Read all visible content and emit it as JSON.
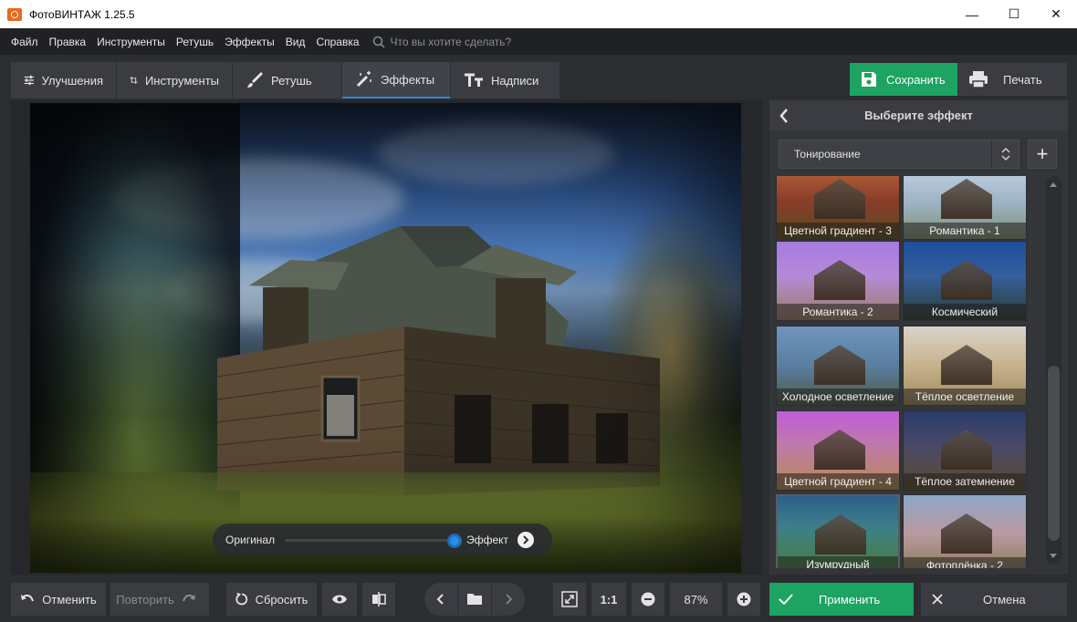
{
  "window": {
    "title": "ФотоВИНТАЖ 1.25.5",
    "minimize_glyph": "—",
    "maximize_glyph": "☐",
    "close_glyph": "✕"
  },
  "menu": {
    "items": [
      "Файл",
      "Правка",
      "Инструменты",
      "Ретушь",
      "Эффекты",
      "Вид",
      "Справка"
    ],
    "search_placeholder": "Что вы хотите сделать?"
  },
  "tabs": [
    {
      "label": "Улучшения",
      "icon": "sliders-icon"
    },
    {
      "label": "Инструменты",
      "icon": "crop-icon"
    },
    {
      "label": "Ретушь",
      "icon": "brush-icon"
    },
    {
      "label": "Эффекты",
      "icon": "magic-wand-icon",
      "active": true
    },
    {
      "label": "Надписи",
      "icon": "text-icon"
    }
  ],
  "toolbar": {
    "save_label": "Сохранить",
    "print_label": "Печать"
  },
  "compare": {
    "original_label": "Оригинал",
    "effect_label": "Эффект",
    "position": 1.0
  },
  "panel": {
    "title": "Выберите эффект",
    "category": "Тонирование",
    "add_glyph": "+",
    "effects": [
      {
        "label": "Цветной градиент - 3",
        "tint": "warm-red"
      },
      {
        "label": "Романтика - 1",
        "tint": "pale-blue"
      },
      {
        "label": "Романтика - 2",
        "tint": "violet"
      },
      {
        "label": "Космический",
        "tint": "deep-blue"
      },
      {
        "label": "Холодное осветление",
        "tint": "cold"
      },
      {
        "label": "Тёплое осветление",
        "tint": "warm"
      },
      {
        "label": "Цветной градиент - 4",
        "tint": "magenta"
      },
      {
        "label": "Тёплое затемнение",
        "tint": "warm-dark"
      },
      {
        "label": "Изумрудный",
        "tint": "emerald",
        "selected": true
      },
      {
        "label": "Фотоплёнка - 2",
        "tint": "film"
      }
    ]
  },
  "bottom": {
    "undo_label": "Отменить",
    "redo_label": "Повторить",
    "reset_label": "Сбросить",
    "one_to_one": "1:1",
    "zoom": "87%",
    "apply_label": "Применить",
    "cancel_label": "Отмена"
  },
  "colors": {
    "accent_green": "#1da362",
    "accent_blue": "#2f86d6",
    "panel_bg": "#333539",
    "app_bg": "#2b2d31"
  }
}
